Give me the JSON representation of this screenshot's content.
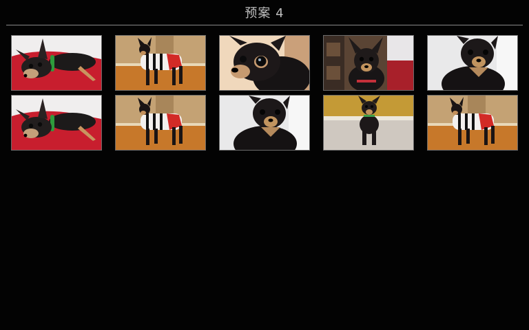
{
  "header": {
    "title": "预案 4"
  },
  "thumbnails": [
    {
      "scene": "lying-red-pillow",
      "icon": "dog-photo-icon"
    },
    {
      "scene": "standing-sweater",
      "icon": "dog-photo-icon"
    },
    {
      "scene": "closeup-face",
      "icon": "dog-photo-icon"
    },
    {
      "scene": "sitting-shelf",
      "icon": "dog-photo-icon"
    },
    {
      "scene": "portrait-white",
      "icon": "dog-photo-icon"
    },
    {
      "scene": "lying-red-pillow",
      "icon": "dog-photo-icon"
    },
    {
      "scene": "standing-sweater",
      "icon": "dog-photo-icon"
    },
    {
      "scene": "portrait-white",
      "icon": "dog-photo-icon"
    },
    {
      "scene": "standing-carpet",
      "icon": "dog-photo-icon"
    },
    {
      "scene": "standing-sweater",
      "icon": "dog-photo-icon"
    }
  ],
  "colors": {
    "background": "#030303",
    "title_text": "#bdbdbd",
    "divider": "#8a8a8a",
    "thumb_border": "#6b6b6b"
  }
}
